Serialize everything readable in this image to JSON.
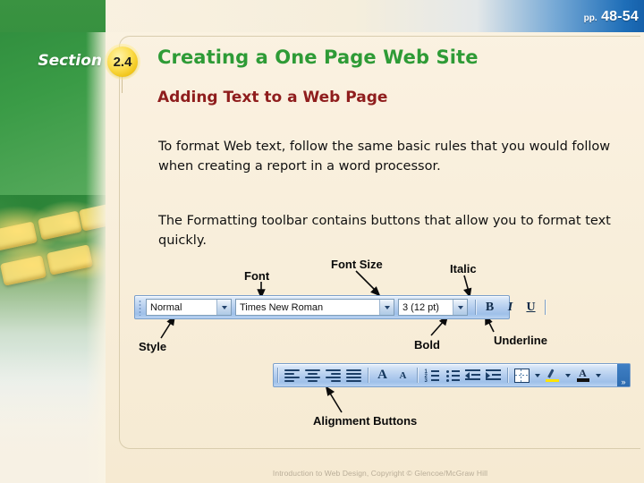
{
  "header": {
    "section_word": "Section",
    "section_number": "2.4",
    "title": "Creating a One Page Web Site",
    "subtitle": "Adding Text to a Web Page",
    "pages_label": "pp.",
    "pages_value": "48-54"
  },
  "body": {
    "paragraph1": "To format Web text, follow the same basic rules that you would follow when creating a report in a word processor.",
    "paragraph2": "The Formatting toolbar contains buttons that allow you to format text quickly."
  },
  "callouts": {
    "font": "Font",
    "font_size": "Font Size",
    "italic": "Italic",
    "style": "Style",
    "bold": "Bold",
    "underline": "Underline",
    "alignment": "Alignment Buttons"
  },
  "formatting_toolbar": {
    "style_value": "Normal",
    "font_value": "Times New Roman",
    "size_value": "3  (12 pt)",
    "bold_label": "B",
    "italic_label": "I",
    "underline_label": "U"
  },
  "alignment_toolbar": {
    "grow_label": "A",
    "shrink_label": "A",
    "numbers": [
      "1",
      "2",
      "3"
    ],
    "overflow_label": "»"
  },
  "footer": {
    "credit": "Introduction to Web Design, Copyright © Glencoe/McGraw Hill"
  },
  "colors": {
    "green": "#2e9b36",
    "dark_red": "#8f1d1d",
    "badge_yellow": "#fcdd4e",
    "blue_bar": "#1e6eb8",
    "cream": "#f8eeda"
  }
}
